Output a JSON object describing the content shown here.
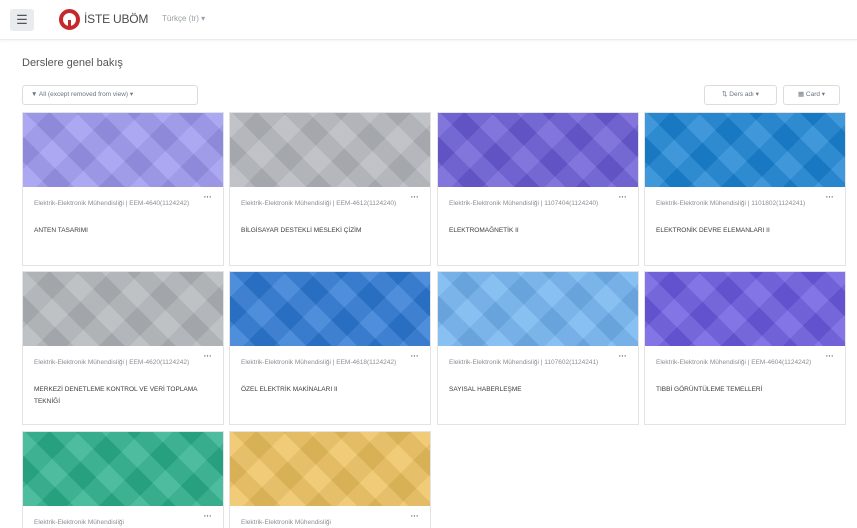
{
  "navbar": {
    "menu_icon": "☰",
    "site_name": "İSTE UBÖM",
    "language": "Türkçe (tr) ▾"
  },
  "page": {
    "section_title": "Derslere genel bakış"
  },
  "toolbar": {
    "filter_label": "▼ All (except removed from view) ▾",
    "sort_label": "⇅ Ders adı ▾",
    "view_label": "▦ Card ▾"
  },
  "courses": [
    {
      "dept": "Elektrik-Elektronik Mühendisliği | EEM-4640(1124242)",
      "name": "ANTEN TASARIMI",
      "menu": "···",
      "color": "#9c97ee"
    },
    {
      "dept": "Elektrik-Elektronik Mühendisliği | EEM-4612(1124240)",
      "name": "BİLGİSAYAR DESTEKLİ MESLEKİ ÇİZİM",
      "menu": "···",
      "color": "#b4b7bd"
    },
    {
      "dept": "Elektrik-Elektronik Mühendisliği | 1107404(1124240)",
      "name": "ELEKTROMAĞNETİK II",
      "menu": "···",
      "color": "#6a5bd6"
    },
    {
      "dept": "Elektrik-Elektronik Mühendisliği | 1101802(1124241)",
      "name": "ELEKTRONİK DEVRE ELEMANLARI II",
      "menu": "···",
      "color": "#1a84d4"
    },
    {
      "dept": "Elektrik-Elektronik Mühendisliği | EEM-4620(1124242)",
      "name": "MERKEZİ DENETLEME KONTROL VE VERİ TOPLAMA TEKNİĞİ",
      "menu": "···",
      "color": "#b2b6ba"
    },
    {
      "dept": "Elektrik-Elektronik Mühendisliği | EEM-4618(1124242)",
      "name": "ÖZEL ELEKTRİK MAKİNALARI II",
      "menu": "···",
      "color": "#2c78d4"
    },
    {
      "dept": "Elektrik-Elektronik Mühendisliği | 1107602(1124241)",
      "name": "SAYISAL HABERLEŞME",
      "menu": "···",
      "color": "#72b3f0"
    },
    {
      "dept": "Elektrik-Elektronik Mühendisliği | EEM-4604(1124242)",
      "name": "TIBBİ GÖRÜNTÜLEME TEMELLERİ",
      "menu": "···",
      "color": "#6b5ae0"
    },
    {
      "dept": "Elektrik-Elektronik Mühendisliği",
      "name": "",
      "menu": "···",
      "color": "#2bb08c"
    },
    {
      "dept": "Elektrik-Elektronik Mühendisliği",
      "name": "",
      "menu": "···",
      "color": "#edc15e"
    }
  ]
}
